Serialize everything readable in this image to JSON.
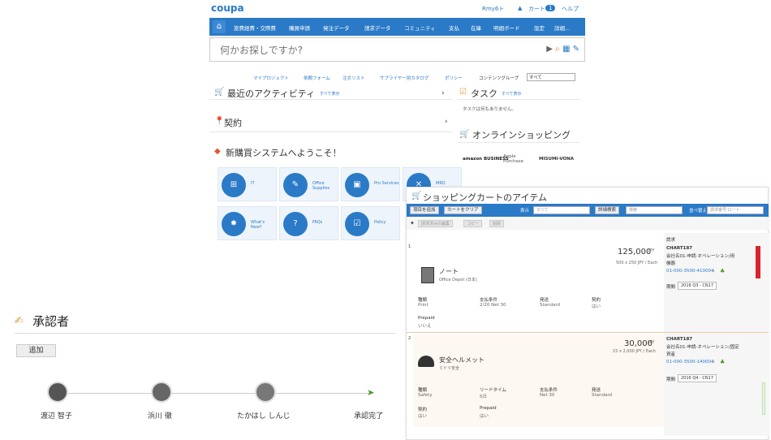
{
  "app": {
    "logo": "coupa"
  },
  "topbar": {
    "links": [
      "Rmy6ト",
      "カート",
      "ヘルプ"
    ],
    "cart_count": "1"
  },
  "nav": {
    "items": [
      "旅費経費・交際費",
      "購買申請",
      "発注データ",
      "請求データ",
      "コミュニティ",
      "支払",
      "在庫",
      "明細ボード",
      "設定",
      "詳細..."
    ]
  },
  "search": {
    "placeholder": "何かお探しですか?"
  },
  "subnav": {
    "items": [
      "マイプロジェクト",
      "依頼フォーム",
      "注文リスト",
      "サプライヤー別カタログ",
      "ポリシー"
    ],
    "group_label": "コンテンツグループ",
    "group_value": "すべて"
  },
  "sections": {
    "activity": {
      "title": "最近のアクティビティ",
      "link": "すべて表示"
    },
    "tasks": {
      "title": "タスク",
      "link": "すべて表示",
      "empty": "タスクは何もありません。"
    },
    "contracts": {
      "title": "契約"
    },
    "online": {
      "title": "オンラインショッピング"
    },
    "welcome": {
      "title": "新購買システムへようこそ！"
    }
  },
  "shops": [
    "amazon BUSINESS",
    "Apple Purchase",
    "MISUMI-VONA"
  ],
  "tiles": [
    {
      "label": "IT",
      "icon": "network-icon"
    },
    {
      "label": "Office Supplies",
      "icon": "pencil-icon"
    },
    {
      "label": "Pro Services",
      "icon": "briefcase-icon"
    },
    {
      "label": "MRO",
      "icon": "tools-icon"
    },
    {
      "label": "What's New?",
      "icon": "new-badge-icon"
    },
    {
      "label": "FAQs",
      "icon": "faq-icon"
    },
    {
      "label": "Policy",
      "icon": "checklist-icon"
    }
  ],
  "cart": {
    "title": "ショッピングカートのアイテム",
    "buttons": {
      "add": "項目を追加",
      "clear": "カートをクリア"
    },
    "show_label": "表示",
    "show_value": "すべて",
    "adv_search": "詳細検索",
    "search_placeholder": "検索",
    "sort_label": "並べ替え",
    "sort_value": "請求番号:ロート",
    "sub_buttons": [
      "請求済みの編集",
      "コピー",
      "削除"
    ],
    "col_header": "請求",
    "items": [
      {
        "index": "1",
        "price": "125,000",
        "unit": "JPY",
        "sub": "500 x 250 JPY / Each",
        "name": "ノート",
        "supplier": "Office Depot (日本)",
        "fields": [
          [
            "種類",
            "Print"
          ],
          [
            "支払条件",
            "2/20 Net 30"
          ],
          [
            "発送",
            "Standard"
          ],
          [
            "契約",
            "はい"
          ]
        ],
        "extra": [
          [
            "Prepaid",
            "いいえ"
          ]
        ],
        "right": {
          "id": "CHART187",
          "line1": "会社名01-申請-オペレーション/用",
          "line2": "機器",
          "acct": "01-000-3500-410004",
          "period": "期間",
          "period_val": "2016 Q3 - CN17"
        }
      },
      {
        "index": "2",
        "price": "30,000",
        "unit": "JPY",
        "sub": "15 x 2,000 JPY / Each",
        "name": "安全ヘルメット",
        "supplier": "ミドリ安全",
        "fields": [
          [
            "種類",
            "Safety"
          ],
          [
            "リードタイム",
            "5日"
          ],
          [
            "支払条件",
            "Net 30"
          ],
          [
            "発送",
            "Standard"
          ]
        ],
        "extra": [
          [
            "契約",
            "はい"
          ],
          [
            "Prepaid",
            "はい"
          ]
        ],
        "right": {
          "id": "CHART187",
          "line1": "会社名01-申請-オペレーション/固定",
          "line2": "資産",
          "acct": "01-000-3500-140004",
          "period": "期間",
          "period_val": "2016 Q4 - CN17"
        }
      }
    ]
  },
  "approvers": {
    "title": "承認者",
    "add": "追加",
    "people": [
      "渡辺 智子",
      "浜川 徹",
      "たかはし しんじ"
    ],
    "done": "承認完了"
  },
  "colors": {
    "brand": "#2a7ac7",
    "accent": "#e07a2a",
    "alert": "#d9232d"
  }
}
